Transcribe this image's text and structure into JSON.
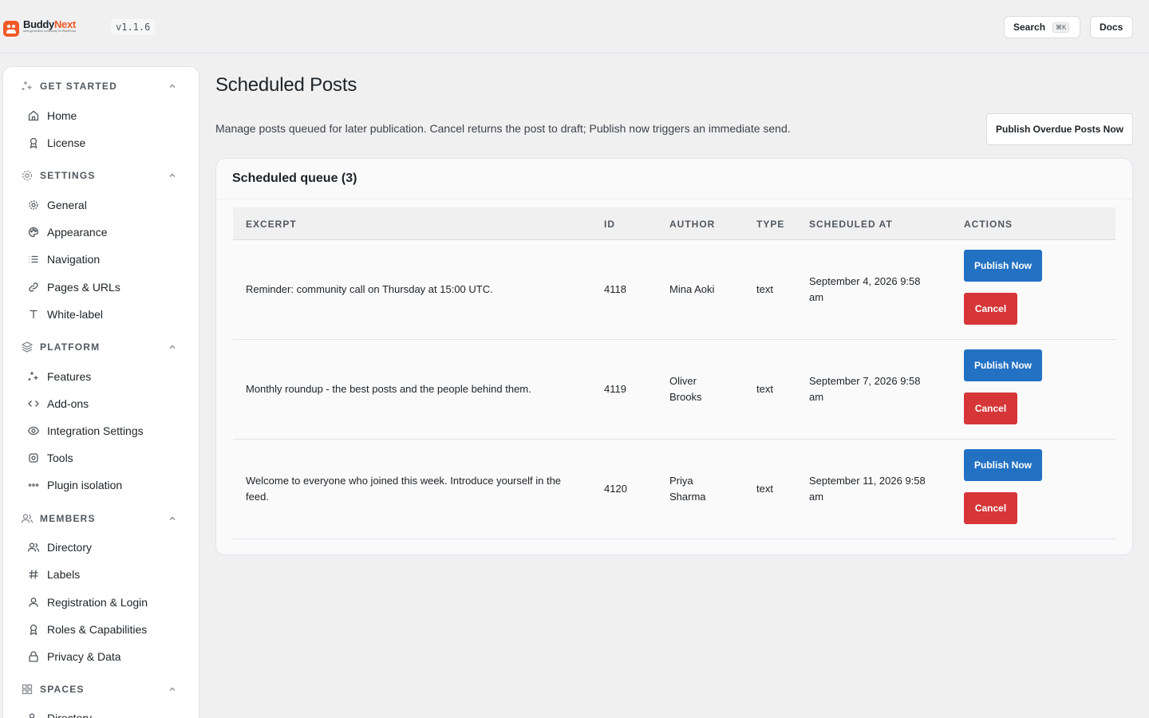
{
  "topbar": {
    "brand_first": "Buddy",
    "brand_second": "Next",
    "brand_tagline": "Next-generation community for WordPress",
    "version": "v1.1.6",
    "search_label": "Search",
    "search_shortcut": "⌘K",
    "docs_label": "Docs"
  },
  "sidebar": {
    "sections": [
      {
        "label": "GET STARTED",
        "items": [
          {
            "label": "Home"
          },
          {
            "label": "License"
          }
        ]
      },
      {
        "label": "SETTINGS",
        "items": [
          {
            "label": "General"
          },
          {
            "label": "Appearance"
          },
          {
            "label": "Navigation"
          },
          {
            "label": "Pages & URLs"
          },
          {
            "label": "White-label"
          }
        ]
      },
      {
        "label": "PLATFORM",
        "items": [
          {
            "label": "Features"
          },
          {
            "label": "Add-ons"
          },
          {
            "label": "Integration Settings"
          },
          {
            "label": "Tools"
          },
          {
            "label": "Plugin isolation"
          }
        ]
      },
      {
        "label": "MEMBERS",
        "items": [
          {
            "label": "Directory"
          },
          {
            "label": "Labels"
          },
          {
            "label": "Registration & Login"
          },
          {
            "label": "Roles & Capabilities"
          },
          {
            "label": "Privacy & Data"
          }
        ]
      },
      {
        "label": "SPACES",
        "items": [
          {
            "label": "Directory"
          }
        ]
      }
    ]
  },
  "main": {
    "title": "Scheduled Posts",
    "description": "Manage posts queued for later publication. Cancel returns the post to draft; Publish now triggers an immediate send.",
    "overdue_button": "Publish Overdue Posts Now",
    "queue_title": "Scheduled queue (3)",
    "columns": [
      "EXCERPT",
      "ID",
      "AUTHOR",
      "TYPE",
      "SCHEDULED AT",
      "ACTIONS"
    ],
    "rows": [
      {
        "excerpt_1": "Reminder: community call on Thursday at 15:00 UTC.",
        "excerpt_2": "",
        "id": "4118",
        "author_1": "Mina Aoki",
        "author_2": "",
        "type": "text",
        "scheduled_1": "September 4, 2026 9:58",
        "scheduled_2": "am"
      },
      {
        "excerpt_1": "Monthly roundup - the best posts and the people behind them.",
        "excerpt_2": "",
        "id": "4119",
        "author_1": "Oliver",
        "author_2": "Brooks",
        "type": "text",
        "scheduled_1": "September 7, 2026 9:58",
        "scheduled_2": "am"
      },
      {
        "excerpt_1": "Welcome to everyone who joined this week. Introduce yourself in the",
        "excerpt_2": "feed.",
        "id": "4120",
        "author_1": "Priya",
        "author_2": "Sharma",
        "type": "text",
        "scheduled_1": "September 11, 2026 9:58",
        "scheduled_2": "am"
      }
    ],
    "publish_label": "Publish Now",
    "cancel_label": "Cancel"
  },
  "colors": {
    "primary": "#2271c3",
    "danger": "#d63638",
    "brand": "#f05a28"
  }
}
